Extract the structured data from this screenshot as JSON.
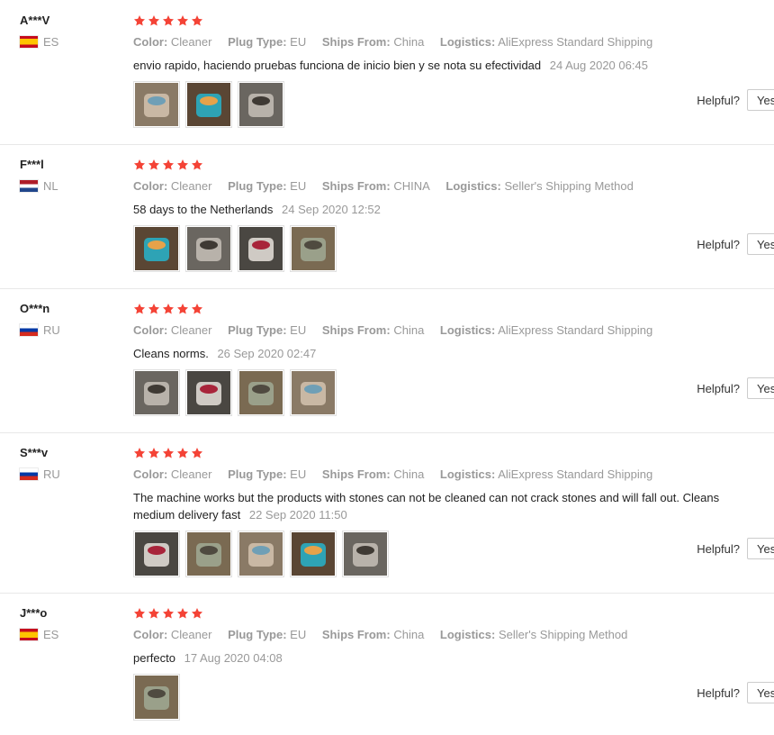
{
  "labels": {
    "color": "Color:",
    "plug_type": "Plug Type:",
    "ships_from": "Ships From:",
    "logistics": "Logistics:",
    "helpful": "Helpful?",
    "yes": "Yes"
  },
  "reviews": [
    {
      "user": "A***V",
      "country": "ES",
      "rating": 5,
      "color": "Cleaner",
      "plug_type": "EU",
      "ships_from": "China",
      "logistics": "AliExpress Standard Shipping",
      "text": "envio rapido, haciendo pruebas funciona de inicio bien y se nota su efectividad",
      "date": "24 Aug 2020 06:45",
      "photos": 3
    },
    {
      "user": "F***l",
      "country": "NL",
      "rating": 5,
      "color": "Cleaner",
      "plug_type": "EU",
      "ships_from": "CHINA",
      "logistics": "Seller's Shipping Method",
      "text": "58 days to the Netherlands",
      "date": "24 Sep 2020 12:52",
      "photos": 4
    },
    {
      "user": "O***n",
      "country": "RU",
      "rating": 5,
      "color": "Cleaner",
      "plug_type": "EU",
      "ships_from": "China",
      "logistics": "AliExpress Standard Shipping",
      "text": "Cleans norms.",
      "date": "26 Sep 2020 02:47",
      "photos": 4
    },
    {
      "user": "S***v",
      "country": "RU",
      "rating": 5,
      "color": "Cleaner",
      "plug_type": "EU",
      "ships_from": "China",
      "logistics": "AliExpress Standard Shipping",
      "text": "The machine works but the products with stones can not be cleaned can not crack stones and will fall out. Cleans medium delivery fast",
      "date": "22 Sep 2020 11:50",
      "photos": 5
    },
    {
      "user": "J***o",
      "country": "ES",
      "rating": 5,
      "color": "Cleaner",
      "plug_type": "EU",
      "ships_from": "China",
      "logistics": "Seller's Shipping Method",
      "text": "perfecto",
      "date": "17 Aug 2020 04:08",
      "photos": 1
    }
  ],
  "colors": {
    "star": "#f44336",
    "muted": "#999999",
    "text": "#222222",
    "divider": "#e8e8e8"
  },
  "icons": {
    "star": "star-icon",
    "flag": "flag-icon"
  }
}
